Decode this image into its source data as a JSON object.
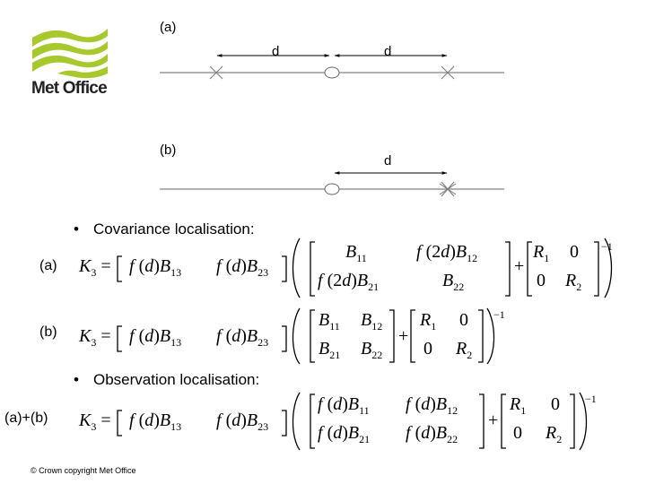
{
  "logo": {
    "name": "Met Office",
    "icon": "met-office-waves-logo",
    "color": "#a8c92e"
  },
  "diagram": {
    "a": {
      "label": "(a)",
      "distance_labels": [
        "d",
        "d"
      ],
      "markers": [
        "observation-x",
        "state-circle",
        "observation-x"
      ]
    },
    "b": {
      "label": "(b)",
      "distance_labels": [
        "d"
      ],
      "markers": [
        "state-circle",
        "double-observation-x"
      ]
    }
  },
  "sections": {
    "covariance": "Covariance localisation:",
    "observation": "Observation localisation:"
  },
  "equations": {
    "a": {
      "label": "(a)",
      "lhs": "K",
      "lhs_sub": "3",
      "row_vector": [
        [
          "f",
          "d",
          "B",
          "13"
        ],
        [
          "f",
          "d",
          "B",
          "23"
        ]
      ],
      "matrix": [
        [
          "B11",
          "f(2d)B12"
        ],
        [
          "f(2d)B21",
          "B22"
        ]
      ],
      "r_matrix": [
        [
          "R1",
          "0"
        ],
        [
          "0",
          "R2"
        ]
      ],
      "power": "−1"
    },
    "b": {
      "label": "(b)",
      "matrix": [
        [
          "B11",
          "B12"
        ],
        [
          "B21",
          "B22"
        ]
      ],
      "power": "−1"
    },
    "ab": {
      "label": "(a)+(b)",
      "matrix": [
        [
          "f(d)B11",
          "f(d)B12"
        ],
        [
          "f(d)B21",
          "f(d)B22"
        ]
      ],
      "power": "−1"
    }
  },
  "footer": "© Crown copyright   Met Office"
}
